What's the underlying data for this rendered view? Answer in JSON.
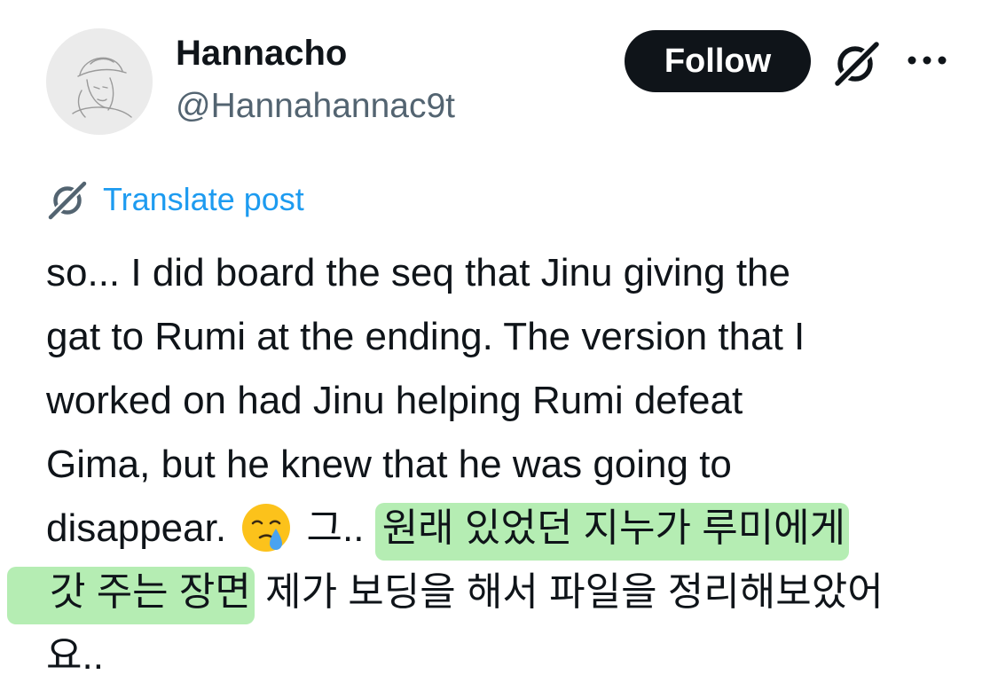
{
  "author": {
    "display_name": "Hannacho",
    "handle": "@Hannahannac9t"
  },
  "actions": {
    "follow_label": "Follow",
    "grok_icon": "grok-icon",
    "more_icon": "more-icon"
  },
  "translate": {
    "label": "Translate post",
    "icon": "grok-icon"
  },
  "post": {
    "lines": [
      "so... I did board the seq that Jinu giving the",
      "gat to Rumi at the ending. The version that I",
      "worked on had Jinu helping Rumi defeat",
      "Gima, but he knew that he was going to"
    ],
    "line5_text": "disappear.",
    "emoji": "face-holding-back-tears",
    "line5_korean_pre": "그..",
    "line5_korean_highlight": "원래 있었던 지누가 루미에게",
    "line6_highlight": "갓 주는 장면",
    "line6_rest": "제가 보딩을 해서 파일을 정리해보았어",
    "line7": "요.."
  },
  "colors": {
    "text": "#0f1419",
    "secondary": "#536471",
    "link": "#1d9bf0",
    "highlight": "#b5edb3",
    "button_bg": "#0f1419"
  }
}
